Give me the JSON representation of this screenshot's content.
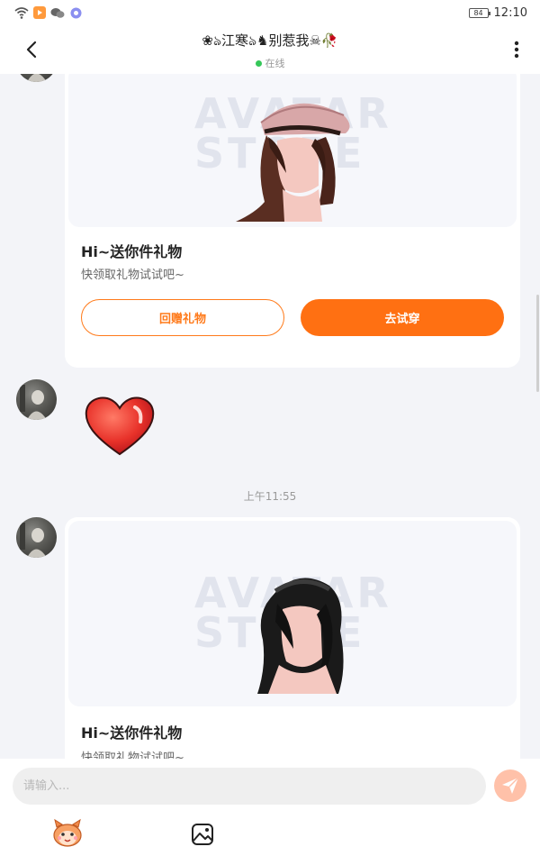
{
  "status_bar": {
    "time": "12:10",
    "battery": "84",
    "icons": [
      "wifi-icon",
      "video-app-icon",
      "wechat-icon",
      "app-notification-icon"
    ]
  },
  "header": {
    "title": "❀ঌ江寒ঌ♞别惹我☠🥀",
    "status": "在线",
    "back_icon": "chevron-left-icon",
    "more_icon": "more-vertical-icon",
    "status_color": "#35c759"
  },
  "messages": [
    {
      "type": "gift",
      "image": "avatar-hair-brown-beret",
      "watermark": "AVATAR STORE",
      "title": "Hi~送你件礼物",
      "subtitle": "快领取礼物试试吧~",
      "buttons": {
        "return_gift": "回赠礼物",
        "try_on": "去试穿"
      }
    },
    {
      "type": "sticker",
      "sticker": "red-heart"
    },
    {
      "type": "time",
      "text": "上午11:55"
    },
    {
      "type": "gift",
      "image": "avatar-hair-black-long",
      "watermark": "AVATAR STORE",
      "title": "Hi~送你件礼物",
      "subtitle": "快领取礼物试试吧~"
    }
  ],
  "input_bar": {
    "placeholder": "请输入...",
    "send_icon": "send-paper-plane-icon",
    "emoji_icon": "cat-emoji-icon",
    "image_icon": "image-picker-icon"
  },
  "colors": {
    "accent": "#ff7012",
    "background": "#f3f4f8",
    "send_button": "#ffc1a9"
  }
}
